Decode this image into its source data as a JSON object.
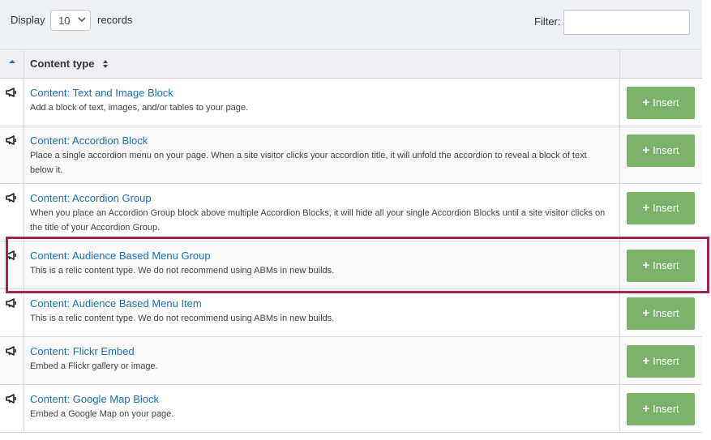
{
  "controls": {
    "display_label": "Display",
    "records_value": "10",
    "records_label": "records",
    "filter_label": "Filter:",
    "filter_value": ""
  },
  "table": {
    "header_content": "Content type",
    "insert_label": "Insert",
    "rows": [
      {
        "title": "Content: Text and Image Block",
        "desc": "Add a block of text, images, and/or tables to your page."
      },
      {
        "title": "Content: Accordion Block",
        "desc": "Place a single accordion menu on your page. When a site visitor clicks your accordion title, it will unfold the accordion to reveal a block of text below it."
      },
      {
        "title": "Content: Accordion Group",
        "desc": "When you place an Accordion Group block above multiple Accordion Blocks, it will hide all your single Accordion Blocks until a site visitor clicks on the title of your Accordion Group."
      },
      {
        "title": "Content: Audience Based Menu Group",
        "desc": "This is a relic content type. We do not recommend using ABMs in new builds."
      },
      {
        "title": "Content: Audience Based Menu Item",
        "desc": "This is a relic content type. We do not recommend using ABMs in new builds."
      },
      {
        "title": "Content: Flickr Embed",
        "desc": "Embed a Flickr gallery or image."
      },
      {
        "title": "Content: Google Map Block",
        "desc": "Embed a Google Map on your page."
      }
    ]
  },
  "icons": {
    "row_icon": "megaphone-icon",
    "header_sort": "sort-up-icon",
    "column_sort": "sort-both-icon"
  },
  "colors": {
    "link": "#1d6fb8",
    "insert_button": "#7bb26a",
    "highlight": "#a3254f"
  }
}
